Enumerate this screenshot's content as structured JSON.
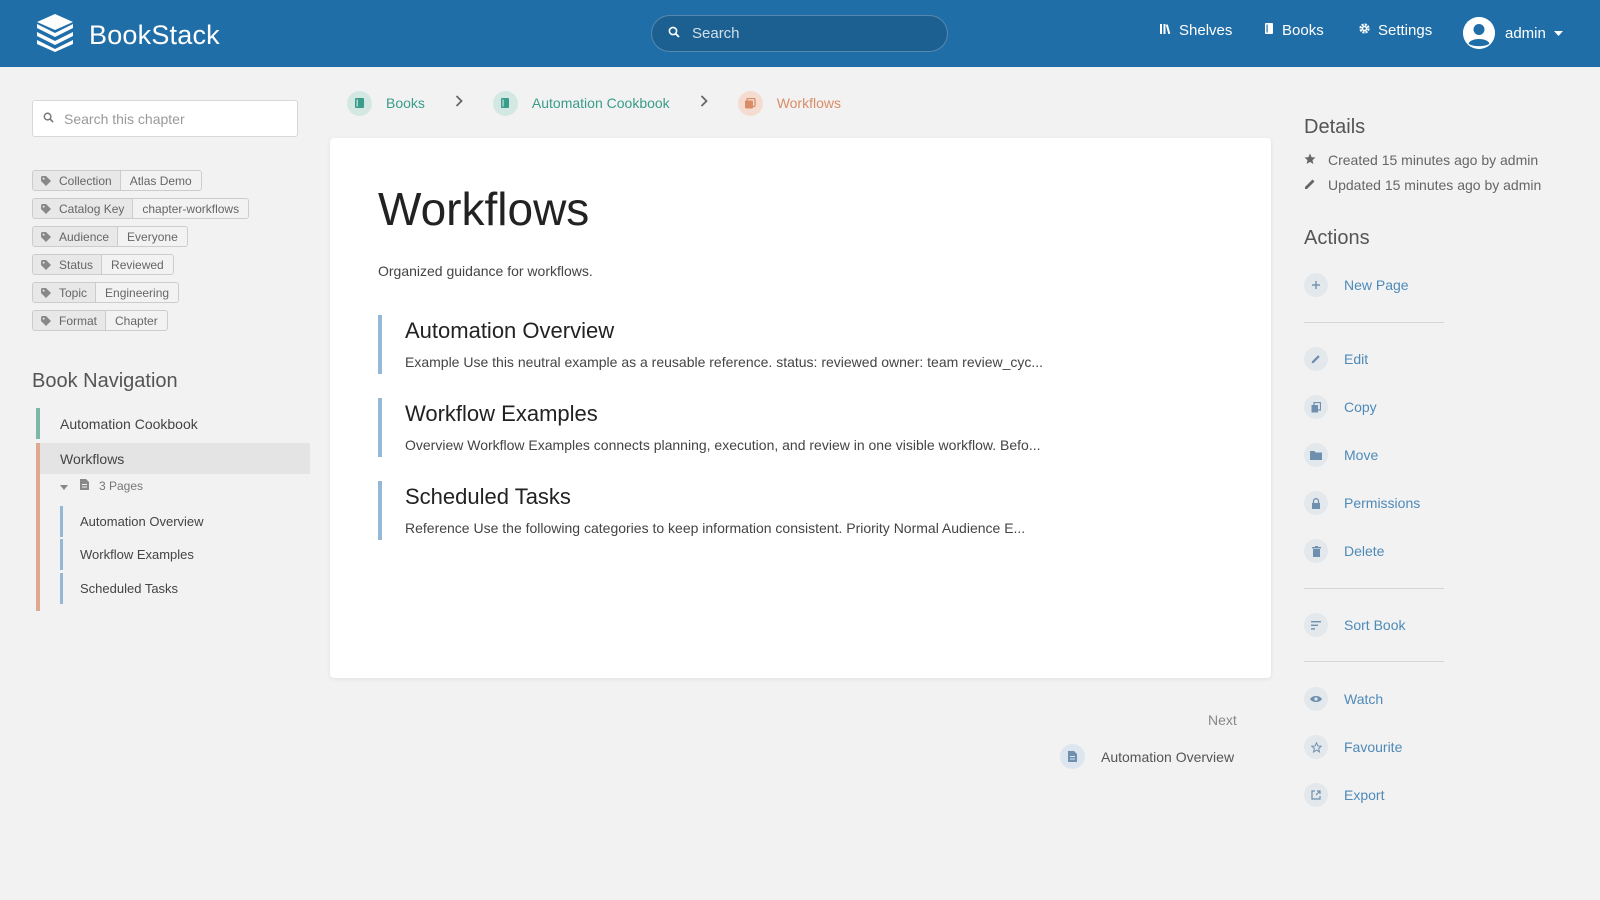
{
  "header": {
    "app_name": "BookStack",
    "search_placeholder": "Search",
    "nav": {
      "shelves": "Shelves",
      "books": "Books",
      "settings": "Settings"
    },
    "user_name": "admin"
  },
  "sidebar": {
    "search_placeholder": "Search this chapter",
    "tags": [
      {
        "name": "Collection",
        "value": "Atlas Demo"
      },
      {
        "name": "Catalog Key",
        "value": "chapter-workflows"
      },
      {
        "name": "Audience",
        "value": "Everyone"
      },
      {
        "name": "Status",
        "value": "Reviewed"
      },
      {
        "name": "Topic",
        "value": "Engineering"
      },
      {
        "name": "Format",
        "value": "Chapter"
      }
    ],
    "book_nav_title": "Book Navigation",
    "book_name": "Automation Cookbook",
    "chapter_name": "Workflows",
    "pages_toggle": "3 Pages",
    "pages": [
      "Automation Overview",
      "Workflow Examples",
      "Scheduled Tasks"
    ]
  },
  "breadcrumb": {
    "books": "Books",
    "book": "Automation Cookbook",
    "chapter": "Workflows"
  },
  "main": {
    "title": "Workflows",
    "description": "Organized guidance for workflows.",
    "entries": [
      {
        "title": "Automation Overview",
        "excerpt": "Example Use this neutral example as a reusable reference. status: reviewed owner: team review_cyc..."
      },
      {
        "title": "Workflow Examples",
        "excerpt": "Overview Workflow Examples connects planning, execution, and review in one visible workflow. Befo..."
      },
      {
        "title": "Scheduled Tasks",
        "excerpt": "Reference Use the following categories to keep information consistent. Priority Normal Audience E..."
      }
    ]
  },
  "next_nav": {
    "label": "Next",
    "page": "Automation Overview"
  },
  "details": {
    "heading": "Details",
    "created": "Created 15 minutes ago by admin",
    "updated": "Updated 15 minutes ago by admin"
  },
  "actions": {
    "heading": "Actions",
    "new_page": "New Page",
    "edit": "Edit",
    "copy": "Copy",
    "move": "Move",
    "permissions": "Permissions",
    "delete": "Delete",
    "sort_book": "Sort Book",
    "watch": "Watch",
    "favourite": "Favourite",
    "export": "Export"
  },
  "colors": {
    "header_bg": "#206ea7",
    "book_accent": "#3a9c8a",
    "chapter_accent": "#d98c66",
    "page_accent": "#94b8d6",
    "action_link": "#4e8ab8"
  }
}
